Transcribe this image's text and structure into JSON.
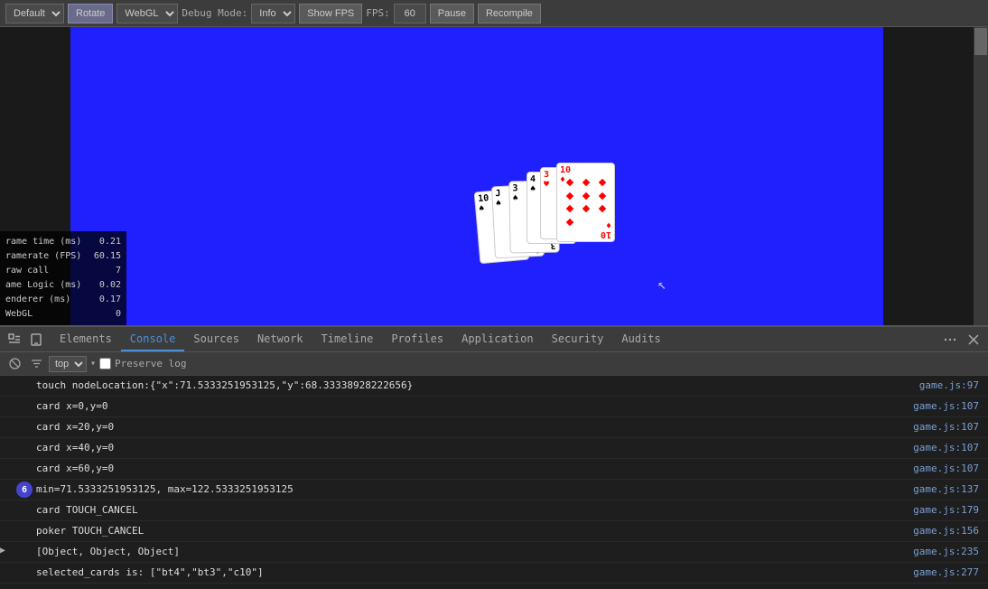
{
  "toolbar": {
    "layout_label": "Default",
    "rotate_label": "Rotate",
    "webgl_label": "WebGL",
    "debug_mode_label": "Debug Mode:",
    "debug_mode_value": "Info",
    "show_fps_label": "Show FPS",
    "fps_label": "FPS:",
    "fps_value": "60",
    "pause_label": "Pause",
    "recompile_label": "Recompile"
  },
  "fps_overlay": {
    "frame_time_label": "rame time (ms)",
    "frame_time_value": "0.21",
    "framerate_label": "ramerate (FPS)",
    "framerate_value": "60.15",
    "draw_call_label": "raw call",
    "draw_call_value": "7",
    "game_logic_label": "ame Logic (ms)",
    "game_logic_value": "0.02",
    "renderer_label": "enderer (ms)",
    "renderer_value": "0.17",
    "webgl_label": "WebGL",
    "webgl_value": "0"
  },
  "devtools": {
    "tabs": [
      {
        "id": "elements",
        "label": "Elements"
      },
      {
        "id": "console",
        "label": "Console",
        "active": true
      },
      {
        "id": "sources",
        "label": "Sources"
      },
      {
        "id": "network",
        "label": "Network"
      },
      {
        "id": "timeline",
        "label": "Timeline"
      },
      {
        "id": "profiles",
        "label": "Profiles"
      },
      {
        "id": "application",
        "label": "Application"
      },
      {
        "id": "security",
        "label": "Security"
      },
      {
        "id": "audits",
        "label": "Audits"
      }
    ]
  },
  "console": {
    "filter_value": "top",
    "preserve_label": "Preserve log",
    "rows": [
      {
        "id": 1,
        "badge": "",
        "arrow": "",
        "text": "touch nodeLocation:{\"x\":71.5333251953125,\"y\":68.33338928222656}",
        "link": "game.js:97"
      },
      {
        "id": 2,
        "badge": "",
        "arrow": "",
        "text": "card x=0,y=0",
        "link": "game.js:107"
      },
      {
        "id": 3,
        "badge": "",
        "arrow": "",
        "text": "card x=20,y=0",
        "link": "game.js:107"
      },
      {
        "id": 4,
        "badge": "",
        "arrow": "",
        "text": "card x=40,y=0",
        "link": "game.js:107"
      },
      {
        "id": 5,
        "badge": "",
        "arrow": "",
        "text": "card x=60,y=0",
        "link": "game.js:107"
      },
      {
        "id": 6,
        "badge": "6",
        "arrow": "",
        "text": "min=71.5333251953125, max=122.5333251953125",
        "link": "game.js:137"
      },
      {
        "id": 7,
        "badge": "",
        "arrow": "",
        "text": "card TOUCH_CANCEL",
        "link": "game.js:179"
      },
      {
        "id": 8,
        "badge": "",
        "arrow": "",
        "text": "poker TOUCH_CANCEL",
        "link": "game.js:156"
      },
      {
        "id": 9,
        "badge": "",
        "arrow": "▶",
        "text": "[Object, Object, Object]",
        "link": "game.js:235"
      },
      {
        "id": 10,
        "badge": "",
        "arrow": "",
        "text": "selected_cards is: [\"bt4\",\"bt3\",\"c10\"]",
        "link": "game.js:277"
      }
    ]
  }
}
